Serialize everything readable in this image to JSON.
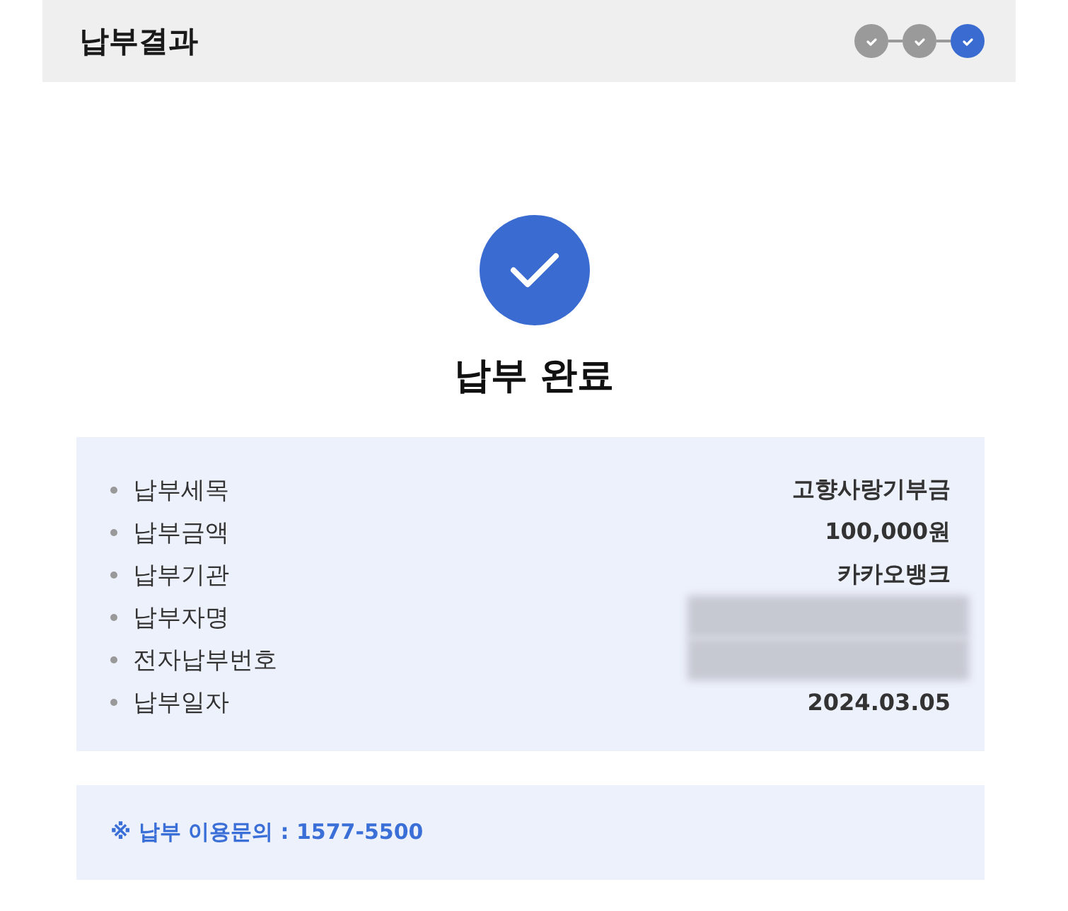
{
  "header": {
    "title": "납부결과",
    "steps": [
      {
        "selected": false
      },
      {
        "selected": false
      },
      {
        "selected": true
      }
    ]
  },
  "result": {
    "title": "납부 완료"
  },
  "details": [
    {
      "kind": "text",
      "label": "납부세목",
      "value": "고향사랑기부금"
    },
    {
      "kind": "text",
      "label": "납부금액",
      "value": "100,000원"
    },
    {
      "kind": "text",
      "label": "납부기관",
      "value": "카카오뱅크"
    },
    {
      "kind": "redacted",
      "label": "납부자명"
    },
    {
      "kind": "redacted",
      "label": "전자납부번호"
    },
    {
      "kind": "text",
      "label": "납부일자",
      "value": "2024.03.05"
    }
  ],
  "notice": "※ 납부 이용문의 : 1577-5500"
}
